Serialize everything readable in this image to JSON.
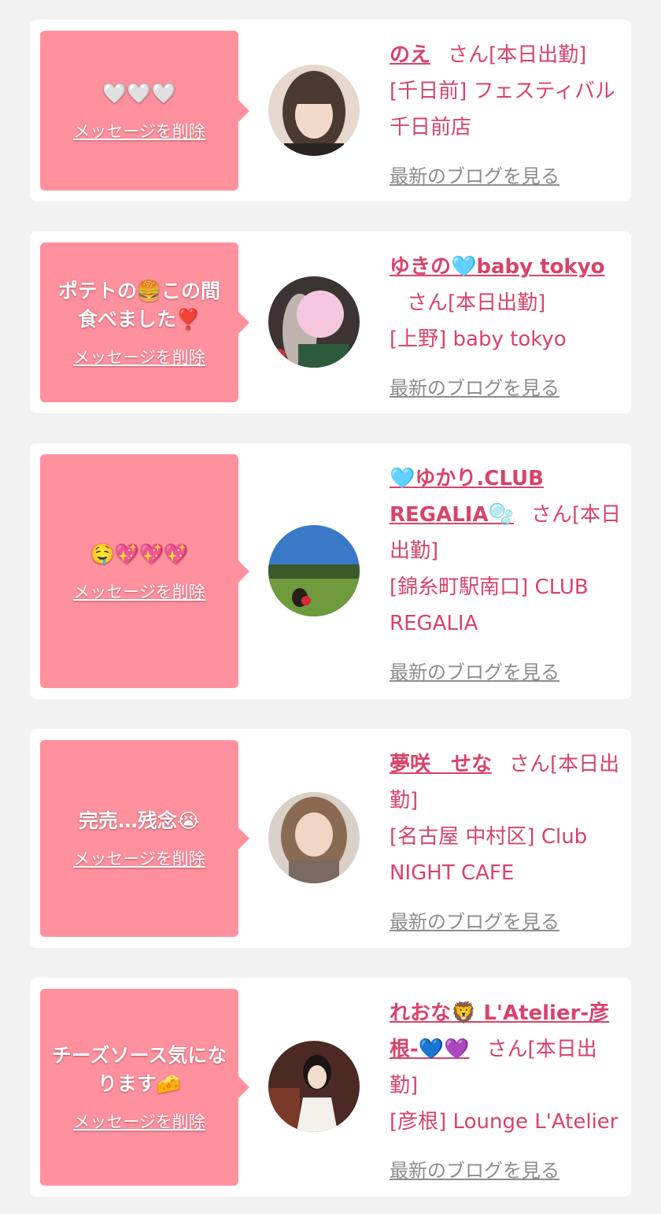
{
  "common": {
    "delete_label": "メッセージを削除",
    "blog_label": "最新のブログを見る"
  },
  "cards": [
    {
      "message": "🤍🤍🤍",
      "name": "のえ",
      "suffix": "さん[本日出勤]",
      "shop": "[千日前] フェスティバル 千日前店"
    },
    {
      "message": "ポテトの🍔この間食べました❣️",
      "name": "ゆきの🩵baby tokyo",
      "suffix": "さん[本日出勤]",
      "shop": "[上野] baby tokyo"
    },
    {
      "message": "🤤💖💖💖",
      "name": "🩵ゆかり.CLUB REGALIA🫧",
      "suffix": "さん[本日出勤]",
      "shop": "[錦糸町駅南口] CLUB REGALIA"
    },
    {
      "message": "完売…残念😭",
      "name": "夢咲　せな",
      "suffix": "さん[本日出勤]",
      "shop": "[名古屋 中村区] Club NIGHT CAFE"
    },
    {
      "message": "チーズソース気になります🧀",
      "name": "れおな🦁 L'Atelier-彦根-💙💜",
      "suffix": "さん[本日出勤]",
      "shop": "[彦根] Lounge L'Atelier"
    }
  ],
  "colors": {
    "page_bg": "#f2f2f2",
    "bubble": "#ff919e",
    "name_text": "#d8436a",
    "blog_link": "#8c8c8c"
  }
}
